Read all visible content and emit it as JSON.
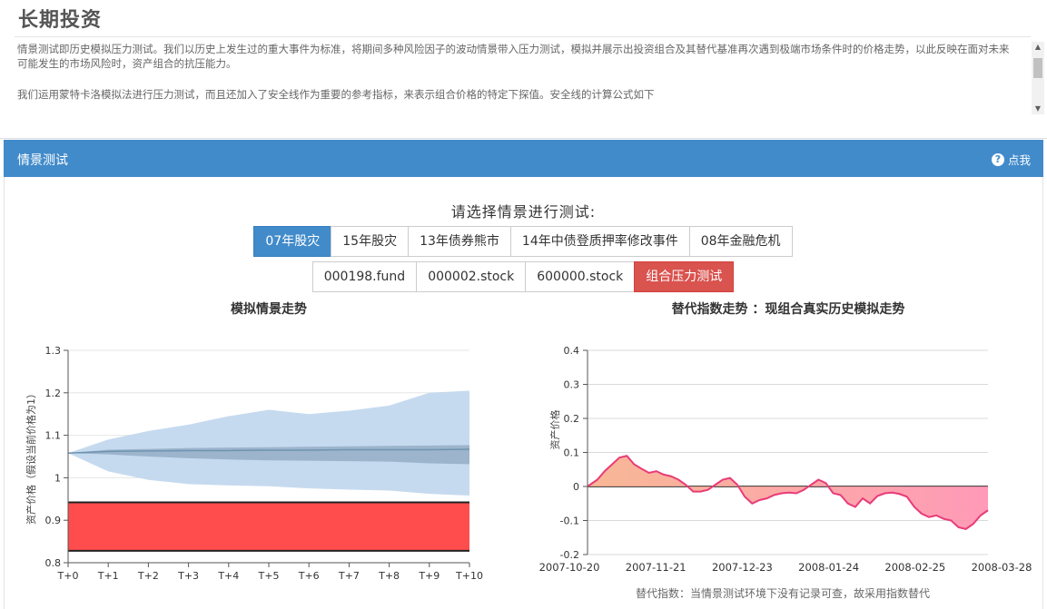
{
  "page": {
    "title": "长期投资",
    "intro_p1": "情景测试即历史模拟压力测试。我们以历史上发生过的重大事件为标准，将期间多种风险因子的波动情景带入压力测试，模拟并展示出投资组合及其替代基准再次遇到极端市场条件时的价格走势，以此反映在面对未来可能发生的市场风险时，资产组合的抗压能力。",
    "intro_p2": "我们运用蒙特卡洛模拟法进行压力测试，而且还加入了安全线作为重要的参考指标，来表示组合价格的特定下探值。安全线的计算公式如下"
  },
  "panel": {
    "title": "情景测试",
    "help_label": "点我",
    "help_icon": "question-circle-icon",
    "prompt": "请选择情景进行测试:",
    "scenarios": [
      "07年股灾",
      "15年股灾",
      "13年债券熊市",
      "14年中债登质押率修改事件",
      "08年金融危机"
    ],
    "assets": [
      "000198.fund",
      "000002.stock",
      "600000.stock"
    ],
    "combined_label": "组合压力测试",
    "active_scenario": "07年股灾"
  },
  "colors": {
    "header": "#428bca",
    "active": "#428bca",
    "combined": "#d9534f",
    "band": "#c3d8ee",
    "safety": "#ff4c4c",
    "area_pink": "#f7a0a0",
    "area_line": "#e83c78"
  },
  "chart_data": [
    {
      "type": "area",
      "title": "模拟情景走势",
      "ylabel": "资产价格（假设当前价格为1）",
      "x": [
        "T+0",
        "T+1",
        "T+2",
        "T+3",
        "T+4",
        "T+5",
        "T+6",
        "T+7",
        "T+8",
        "T+9",
        "T+10"
      ],
      "ylim": [
        0.8,
        1.3
      ],
      "yticks": [
        0.8,
        0.9,
        1,
        1.1,
        1.2,
        1.3
      ],
      "series": [
        {
          "upper": [
            1.058,
            1.09,
            1.11,
            1.125,
            1.145,
            1.16,
            1.15,
            1.158,
            1.17,
            1.2,
            1.205
          ],
          "lower": [
            1.058,
            1.015,
            0.995,
            0.985,
            0.982,
            0.98,
            0.975,
            0.972,
            0.97,
            0.962,
            0.958
          ]
        },
        {
          "upper": [
            1.058,
            1.066,
            1.068,
            1.07,
            1.071,
            1.072,
            1.073,
            1.074,
            1.075,
            1.076,
            1.077
          ],
          "lower": [
            1.058,
            1.055,
            1.05,
            1.046,
            1.043,
            1.041,
            1.04,
            1.039,
            1.038,
            1.034,
            1.032
          ]
        },
        {
          "values": [
            1.058,
            1.062,
            1.063,
            1.064,
            1.064,
            1.065,
            1.065,
            1.066,
            1.066,
            1.066,
            1.067
          ]
        },
        {
          "upper": [
            0.942,
            0.942,
            0.942,
            0.942,
            0.942,
            0.942,
            0.942,
            0.942,
            0.942,
            0.942,
            0.942
          ],
          "lower": [
            0.828,
            0.828,
            0.828,
            0.828,
            0.828,
            0.828,
            0.828,
            0.828,
            0.828,
            0.828,
            0.828
          ]
        }
      ],
      "grid": true
    },
    {
      "type": "area",
      "title": "替代指数走势 ：现组合真实历史模拟走势",
      "ylabel": "资产价格",
      "xticks": [
        "2007-10-20",
        "2007-11-21",
        "2007-12-23",
        "2008-01-24",
        "2008-02-25",
        "2008-03-28"
      ],
      "ylim": [
        -0.2,
        0.4
      ],
      "yticks": [
        -0.2,
        -0.1,
        0,
        0.1,
        0.2,
        0.3,
        0.4
      ],
      "x_days": [
        0,
        4,
        7,
        10,
        13,
        16,
        19,
        22,
        25,
        28,
        31,
        34,
        37,
        40,
        43,
        46,
        49,
        52,
        55,
        58,
        61,
        64,
        67,
        70,
        73,
        76,
        79,
        82,
        85,
        88,
        91,
        94,
        97,
        100,
        103,
        106,
        109,
        112,
        115,
        118,
        121,
        124,
        127,
        130,
        133,
        136,
        139,
        142,
        145,
        148,
        151,
        154,
        157,
        160,
        163
      ],
      "values": [
        0.0,
        0.02,
        0.045,
        0.065,
        0.085,
        0.09,
        0.065,
        0.052,
        0.04,
        0.045,
        0.035,
        0.03,
        0.02,
        0.005,
        -0.015,
        -0.015,
        -0.01,
        0.005,
        0.02,
        0.025,
        0.005,
        -0.03,
        -0.05,
        -0.04,
        -0.035,
        -0.025,
        -0.02,
        -0.018,
        -0.02,
        -0.01,
        0.005,
        0.02,
        0.01,
        -0.02,
        -0.025,
        -0.05,
        -0.06,
        -0.035,
        -0.05,
        -0.028,
        -0.02,
        -0.018,
        -0.022,
        -0.03,
        -0.06,
        -0.08,
        -0.09,
        -0.085,
        -0.095,
        -0.1,
        -0.12,
        -0.125,
        -0.11,
        -0.085,
        -0.07
      ],
      "grid": true,
      "note": "替代指数：当情景测试环境下没有记录可查，故采用指数替代"
    }
  ]
}
